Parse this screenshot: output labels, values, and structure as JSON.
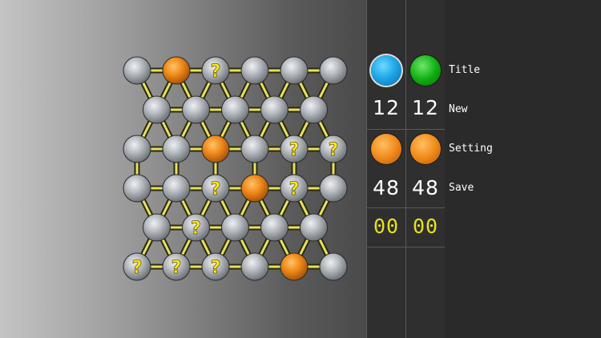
{
  "board": {
    "rows": [
      {
        "offset": false,
        "nodes": [
          "gray",
          "orange",
          "question",
          "gray",
          "gray",
          "gray"
        ]
      },
      {
        "offset": true,
        "nodes": [
          "gray",
          "gray",
          "gray",
          "gray",
          "gray"
        ]
      },
      {
        "offset": false,
        "nodes": [
          "gray",
          "gray",
          "orange",
          "gray",
          "question",
          "question"
        ]
      },
      {
        "offset": false,
        "nodes": [
          "gray",
          "gray",
          "question",
          "orange",
          "question",
          "gray"
        ]
      },
      {
        "offset": true,
        "nodes": [
          "gray",
          "question",
          "gray",
          "gray",
          "gray"
        ]
      },
      {
        "offset": false,
        "nodes": [
          "question",
          "question",
          "question",
          "gray",
          "orange",
          "gray"
        ]
      }
    ],
    "question_mark": "?",
    "colors": {
      "gray": "#a9aeb4",
      "orange": "#f08a1a",
      "link": "#e8e060",
      "link_dark": "#2a2a10"
    }
  },
  "scoreboard": {
    "player1": {
      "color": "blue",
      "count": "12",
      "score": "48",
      "timer": "00"
    },
    "player2": {
      "color": "green",
      "count": "12",
      "score": "48",
      "timer": "00"
    }
  },
  "menu": {
    "title": "Title",
    "new": "New",
    "setting": "Setting",
    "save": "Save"
  }
}
